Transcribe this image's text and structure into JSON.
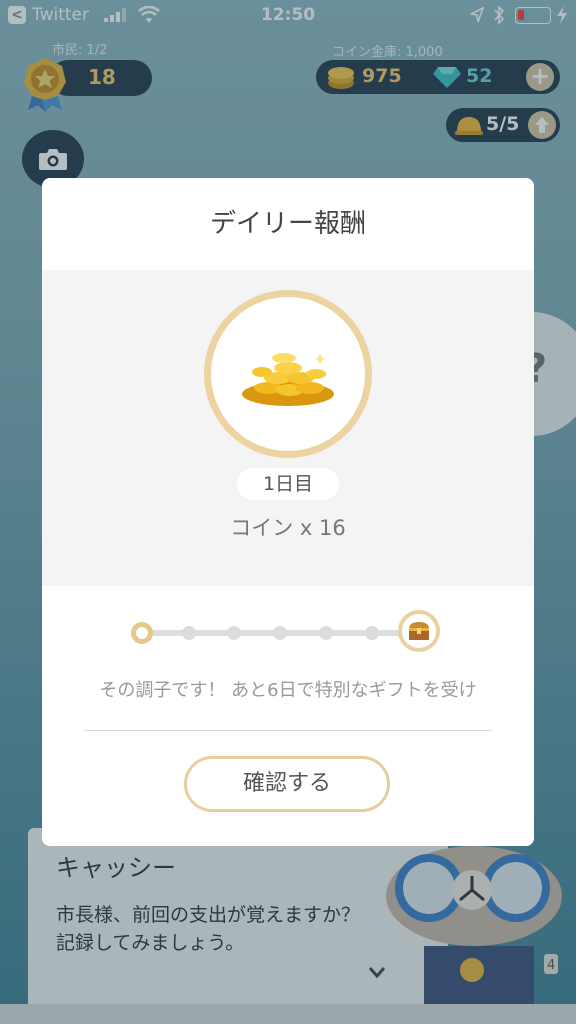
{
  "status_bar": {
    "back_app": "Twitter",
    "time": "12:50"
  },
  "hud": {
    "citizens_label": "市民: 1/2",
    "level": "18",
    "vault_label": "コイン金庫: 1,000",
    "coins": "975",
    "gems": "52",
    "workers": "5/5"
  },
  "modal": {
    "title": "デイリー報酬",
    "day_label": "1日目",
    "reward": "コイン x 16",
    "progress": {
      "current_day": 1,
      "total_days": 7
    },
    "message": "その調子です！ あと6日で特別なギフトを受け",
    "confirm_label": "確認する"
  },
  "dialog": {
    "speaker": "キャッシー",
    "message": "市長様、前回の支出が覚えますか？記録してみましょう。"
  },
  "side_hint": "?",
  "badge_count": "4",
  "colors": {
    "gold": "#e7cf9b",
    "hud_dark": "#24384a",
    "coin_text": "#f3c86a",
    "gem_text": "#6ad4cf"
  }
}
